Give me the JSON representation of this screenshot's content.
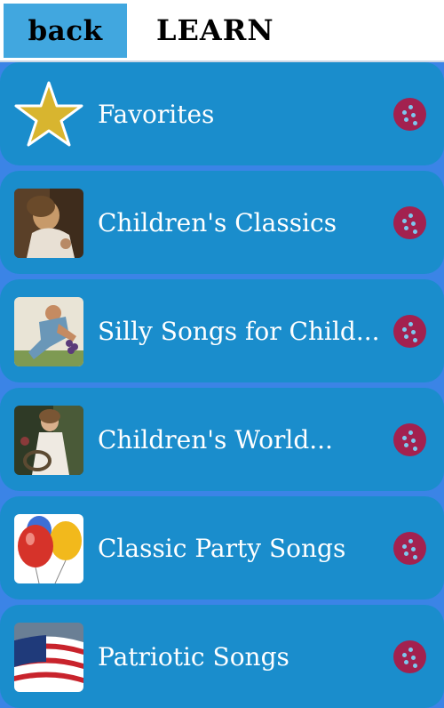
{
  "header": {
    "back_label": "back",
    "title": "LEARN"
  },
  "list": {
    "items": [
      {
        "label": "Favorites",
        "icon": "star-icon"
      },
      {
        "label": "Children's Classics",
        "icon": "girl-painting-thumbnail"
      },
      {
        "label": "Silly Songs for Child...",
        "icon": "man-with-grapes-thumbnail"
      },
      {
        "label": "Children's World...",
        "icon": "girl-with-basket-thumbnail"
      },
      {
        "label": "Classic Party Songs",
        "icon": "balloons-thumbnail"
      },
      {
        "label": "Patriotic Songs",
        "icon": "us-flag-thumbnail"
      }
    ]
  },
  "colors": {
    "background": "#3b84e6",
    "row": "#1a8dcc",
    "back_button": "#41a7df",
    "action_button": "#a3214f",
    "star": "#d8b52f"
  }
}
